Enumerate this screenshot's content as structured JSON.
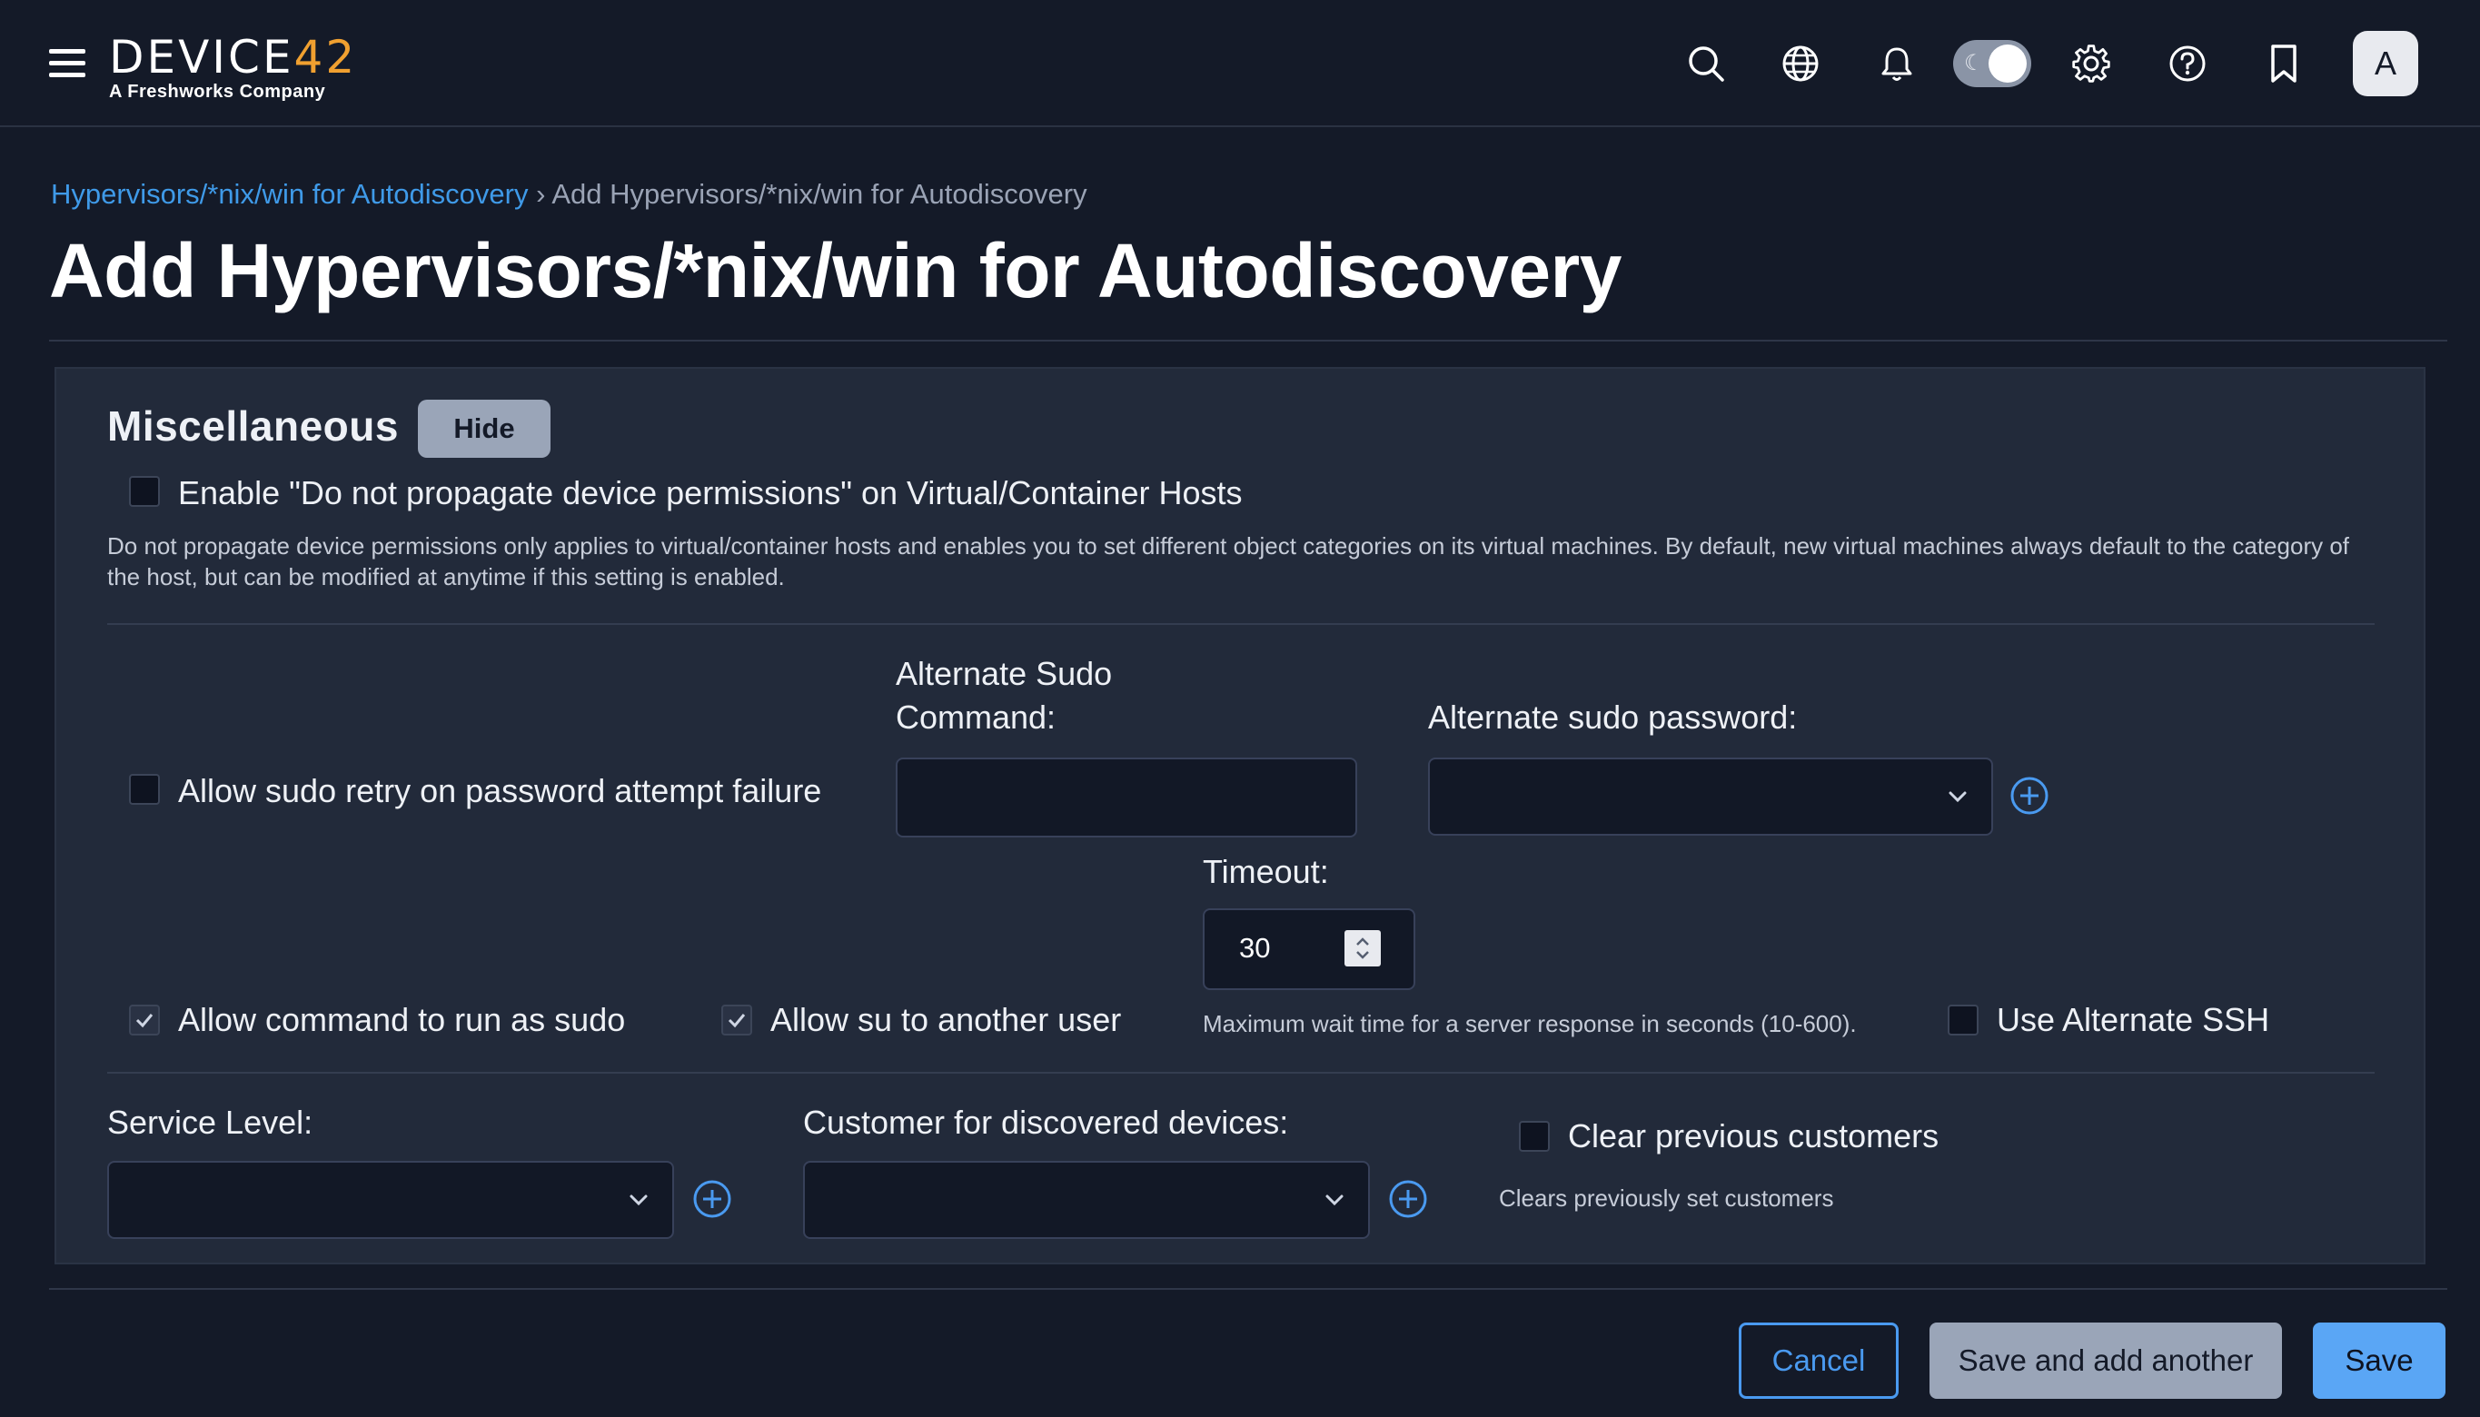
{
  "header": {
    "logo_main_a": "DEVICE",
    "logo_main_b": "42",
    "logo_sub": "A Freshworks Company",
    "icons": [
      "menu-icon",
      "search-icon",
      "globe-icon",
      "bell-icon",
      "theme-toggle",
      "gear-icon",
      "help-icon",
      "bookmark-icon"
    ],
    "avatar_initial": "A"
  },
  "breadcrumb": {
    "parent": "Hypervisors/*nix/win for Autodiscovery",
    "separator": "›",
    "current": "Add Hypervisors/*nix/win for Autodiscovery"
  },
  "page_title": "Add Hypervisors/*nix/win for Autodiscovery",
  "section": {
    "title": "Miscellaneous",
    "hide_label": "Hide",
    "propagate": {
      "label": "Enable \"Do not propagate device permissions\" on Virtual/Container Hosts",
      "checked": false,
      "help_line1": "Do not propagate device permissions only applies to virtual/container hosts and enables you to set different object categories on its virtual machines. By default, new virtual machines always default to the category of",
      "help_line2": "the host, but can be modified at anytime if this setting is enabled."
    },
    "sudo_retry": {
      "label": "Allow sudo retry on password attempt failure",
      "checked": false
    },
    "alt_sudo_command": {
      "label_line1": "Alternate Sudo",
      "label_line2": "Command:",
      "value": ""
    },
    "alt_sudo_password": {
      "label": "Alternate sudo password:",
      "value": ""
    },
    "timeout": {
      "label": "Timeout:",
      "value": "30",
      "help": "Maximum wait time for a server response in seconds (10-600)."
    },
    "run_as_sudo": {
      "label": "Allow command to run as sudo",
      "checked": true
    },
    "su_another": {
      "label": "Allow su to another user",
      "checked": true
    },
    "alt_ssh": {
      "label": "Use Alternate SSH",
      "checked": false
    },
    "service_level": {
      "label": "Service Level:",
      "value": ""
    },
    "customer": {
      "label": "Customer for discovered devices:",
      "value": ""
    },
    "clear_customers": {
      "label": "Clear previous customers",
      "checked": false,
      "help": "Clears previously set customers"
    }
  },
  "footer": {
    "cancel": "Cancel",
    "save_another": "Save and add another",
    "save": "Save"
  },
  "colors": {
    "background": "#141a28",
    "panel": "#222a3a",
    "link": "#3f9ae8",
    "primary_button": "#5aa6f5",
    "secondary_button": "#9aa5b8",
    "logo_accent": "#f0a030"
  }
}
